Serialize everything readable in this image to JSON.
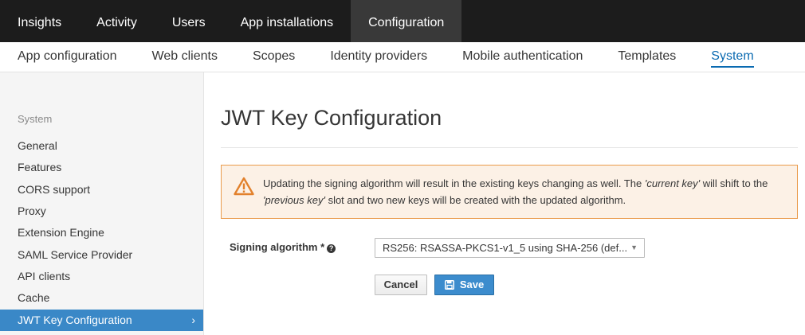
{
  "top_nav": {
    "tabs": [
      {
        "label": "Insights"
      },
      {
        "label": "Activity"
      },
      {
        "label": "Users"
      },
      {
        "label": "App installations"
      },
      {
        "label": "Configuration",
        "active": true
      }
    ]
  },
  "sub_nav": {
    "tabs": [
      {
        "label": "App configuration"
      },
      {
        "label": "Web clients"
      },
      {
        "label": "Scopes"
      },
      {
        "label": "Identity providers"
      },
      {
        "label": "Mobile authentication"
      },
      {
        "label": "Templates"
      },
      {
        "label": "System",
        "active": true
      }
    ]
  },
  "sidebar": {
    "heading": "System",
    "items": [
      {
        "label": "General"
      },
      {
        "label": "Features"
      },
      {
        "label": "CORS support"
      },
      {
        "label": "Proxy"
      },
      {
        "label": "Extension Engine"
      },
      {
        "label": "SAML Service Provider"
      },
      {
        "label": "API clients"
      },
      {
        "label": "Cache"
      },
      {
        "label": "JWT Key Configuration",
        "active": true
      }
    ]
  },
  "main": {
    "title": "JWT Key Configuration",
    "alert": {
      "icon": "warning-icon",
      "text_1": "Updating the signing algorithm will result in the existing keys changing as well. The ",
      "em_1": "'current key'",
      "text_2": " will shift to the ",
      "em_2": "'previous key'",
      "text_3": " slot and two new keys will be created with the updated algorithm."
    },
    "signing_algorithm": {
      "label": "Signing algorithm *",
      "help_icon": "?",
      "value": "RS256: RSASSA-PKCS1-v1_5 using SHA-256 (def..."
    },
    "buttons": {
      "cancel": "Cancel",
      "save": "Save"
    }
  },
  "colors": {
    "top_nav_bg": "#1c1c1c",
    "accent": "#0a6ab1",
    "sidebar_active": "#3a88c7",
    "alert_border": "#ea9b4b",
    "alert_bg": "#fcf1e6",
    "save_button": "#3c8ccd"
  }
}
